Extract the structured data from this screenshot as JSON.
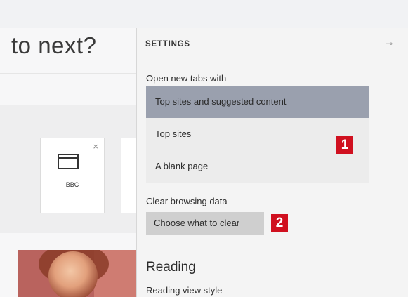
{
  "page": {
    "heading": "to next?",
    "tile": {
      "label": "BBC",
      "close": "×"
    }
  },
  "settings": {
    "title": "SETTINGS",
    "pin_glyph": "⊸",
    "open_tabs_label": "Open new tabs with",
    "options": [
      "Top sites and suggested content",
      "Top sites",
      "A blank page"
    ],
    "selected_option": "Top sites and suggested content",
    "clear_label": "Clear browsing data",
    "clear_button": "Choose what to clear",
    "reading_heading": "Reading",
    "reading_sub": "Reading view style"
  },
  "annotations": {
    "badge1": "1",
    "badge2": "2",
    "color": "#d0101f"
  },
  "colors": {
    "selected": "#9aa0ae",
    "panel": "#f4f4f4",
    "button": "#cfcfcf"
  }
}
